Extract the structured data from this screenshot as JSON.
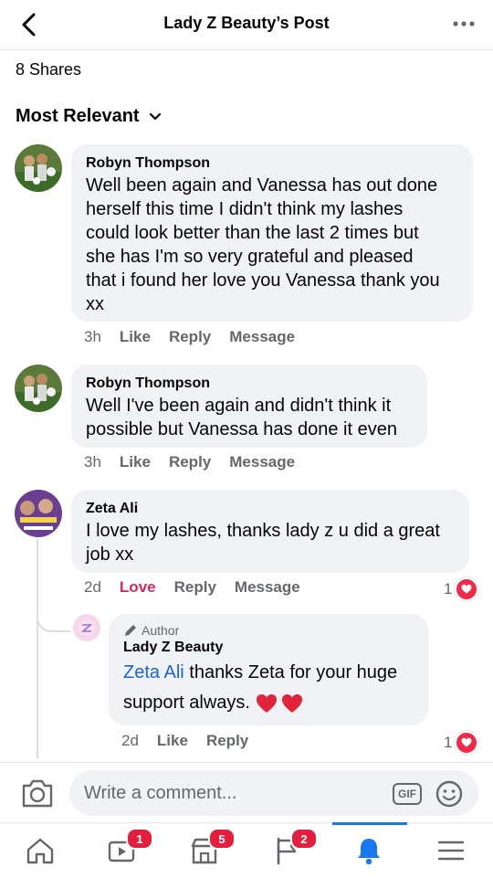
{
  "header": {
    "title": "Lady Z Beauty’s Post"
  },
  "shares": "8 Shares",
  "sort": {
    "label": "Most Relevant"
  },
  "comments": [
    {
      "name": "Robyn Thompson",
      "text_lines": [
        "Well been again and Vanessa has out done",
        "herself this time I didn't think my lashes",
        "could look better than the last 2 times but",
        "she has I'm so very grateful and pleased",
        "that i found her love you Vanessa thank you",
        "xx"
      ],
      "time": "3h",
      "like": "Like",
      "reply": "Reply",
      "message": "Message"
    },
    {
      "name": "Robyn Thompson",
      "text_lines": [
        "Well I've been again and didn't think it",
        "possible but Vanessa has done it even"
      ],
      "time": "3h",
      "like": "Like",
      "reply": "Reply",
      "message": "Message"
    },
    {
      "name": "Zeta Ali",
      "text_lines": [
        "I love my lashes, thanks lady z u did a great",
        "job xx"
      ],
      "time": "2d",
      "like": "Love",
      "reply": "Reply",
      "message": "Message",
      "reaction_count": "1"
    }
  ],
  "reply": {
    "author_tag": "Author",
    "name": "Lady Z Beauty",
    "mention": "Zeta Ali",
    "text_line1": " thanks Zeta for your huge",
    "text_line2": "support always.",
    "time": "2d",
    "like": "Like",
    "reply": "Reply",
    "reaction_count": "1"
  },
  "composer": {
    "placeholder": "Write a comment...",
    "gif_label": "GIF"
  },
  "nav": {
    "badges": {
      "watch": "1",
      "marketplace": "5",
      "pages": "2"
    }
  },
  "colors": {
    "accent": "#1877f2",
    "love": "#e0245e",
    "badge": "#e41e3f",
    "bubble": "#f0f2f5"
  }
}
